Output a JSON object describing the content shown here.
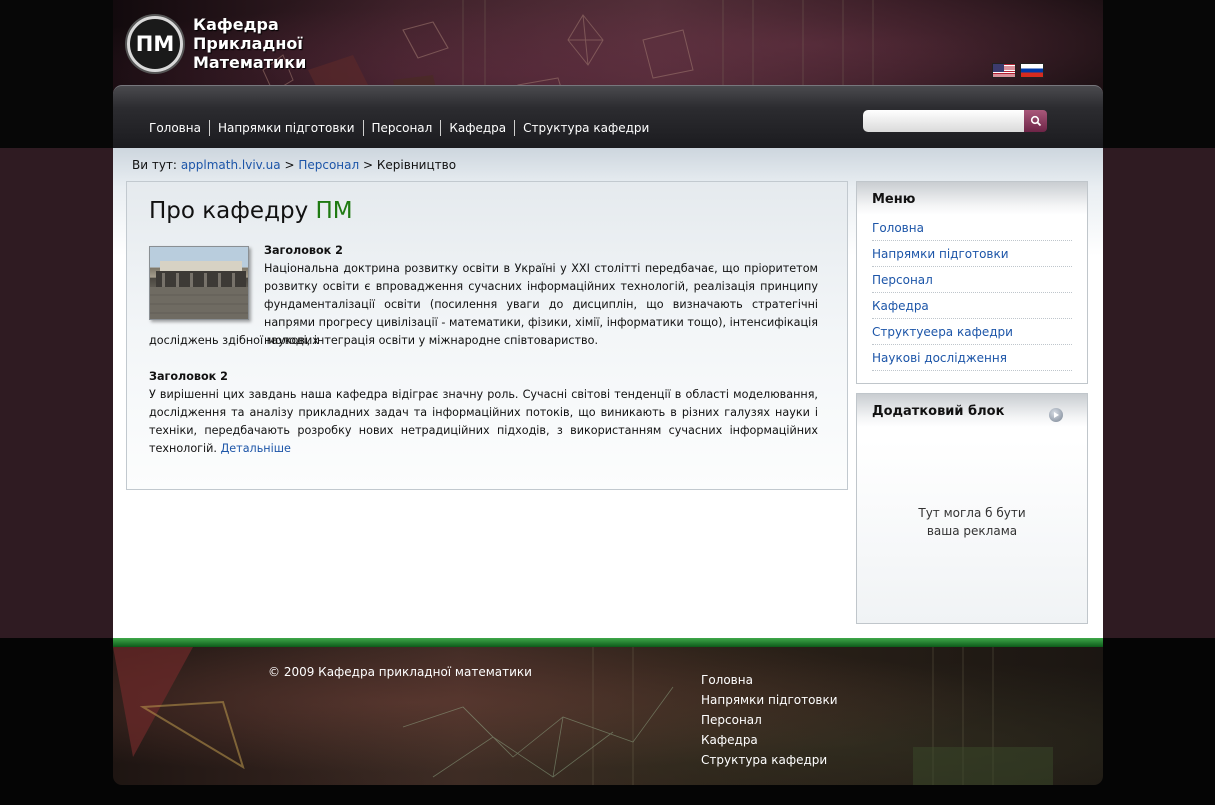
{
  "header": {
    "logo_abbr": "ПМ",
    "logo_lines": [
      "Кафедра",
      "Прикладної",
      "Математики"
    ],
    "languages": [
      "en-flag",
      "ru-flag"
    ]
  },
  "nav": {
    "items": [
      "Головна",
      "Напрямки підготовки",
      "Персонал",
      "Кафедра",
      "Структура кафедри"
    ]
  },
  "search": {
    "placeholder": "",
    "button_icon": "search-icon"
  },
  "breadcrumb": {
    "prefix": "Ви тут:",
    "home": "applmath.lviv.ua",
    "separator": ">",
    "section": "Персонал",
    "current": "Керівництво"
  },
  "content": {
    "title_main": "Про кафедру",
    "title_accent": "ПМ",
    "block1": {
      "heading": "Заголовок 2",
      "text": "Національна доктрина розвитку освіти в Україні у XXI столітті передбачає, що пріоритетом розвитку освіти є впровадження сучасних інформаційних технологій, реалізація принципу фундаменталізації освіти (посилення уваги до дисциплін, що визначають стратегічні напрями прогресу цивілізації - математики, фізики, хімії, інформатики тощо), інтенсифікація наукових",
      "text_cont": "досліджень здібної молоді, інтеграція освіти у міжнародне співтовариство."
    },
    "block2": {
      "heading": "Заголовок 2",
      "text": "У вирішенні цих завдань наша кафедра відіграє значну роль. Сучасні світові тенденції в області моделювання, дослідження та аналізу прикладних задач та інформаційних потоків, що виникають в різних галузях науки і техніки, передбачають розробку нових нетрадиційних підходів, з використанням сучасних інформаційних технологій.",
      "more": "Детальніше"
    }
  },
  "sidebar": {
    "menu_title": "Меню",
    "menu_items": [
      "Головна",
      "Напрямки підготовки",
      "Персонал",
      "Кафедра",
      "Структуеера кафедри",
      "Наукові дослідження"
    ],
    "extra_title": "Додатковий блок",
    "ad_line1": "Тут могла б бути",
    "ad_line2": "ваша реклама"
  },
  "footer": {
    "copyright": "© 2009 Кафедра прикладної математики",
    "links": [
      "Головна",
      "Напрямки підготовки",
      "Персонал",
      "Кафедра",
      "Структура кафедри"
    ]
  },
  "colors": {
    "accent_green": "#1f7a12",
    "link_blue": "#1c55a8",
    "band_maroon": "#2f1b22",
    "search_button": "#8a3a5e"
  }
}
